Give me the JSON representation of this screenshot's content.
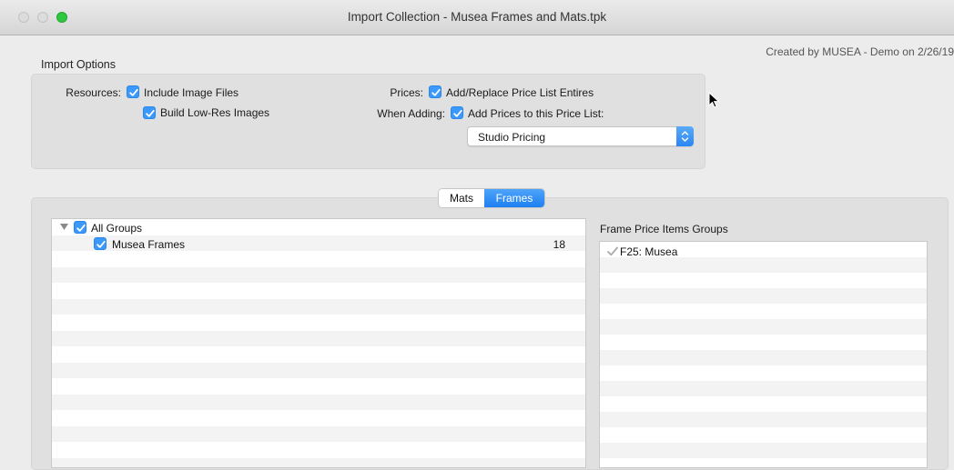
{
  "window": {
    "title": "Import Collection - Musea Frames and Mats.tpk",
    "created_by": "Created by MUSEA - Demo on 2/26/19"
  },
  "import_options": {
    "section_title": "Import Options",
    "resources_label": "Resources:",
    "include_image_files": {
      "label": "Include Image Files",
      "checked": true
    },
    "build_low_res_images": {
      "label": "Build Low-Res Images",
      "checked": true
    },
    "prices_label": "Prices:",
    "add_replace_price_list": {
      "label": "Add/Replace Price List Entires",
      "checked": true
    },
    "when_adding_label": "When Adding:",
    "add_prices_to_list": {
      "label": "Add Prices to this Price List:",
      "checked": true
    },
    "price_list_select": {
      "selected": "Studio Pricing"
    }
  },
  "tabs": [
    {
      "label": "Mats",
      "selected": false
    },
    {
      "label": "Frames",
      "selected": true
    }
  ],
  "groups_tree": {
    "rows": [
      {
        "label": "All Groups",
        "checked": true,
        "expanded": true,
        "count": ""
      },
      {
        "label": "Musea Frames",
        "checked": true,
        "count": "18"
      }
    ]
  },
  "frame_price_items": {
    "header": "Frame Price Items Groups",
    "rows": [
      {
        "label": "F25: Musea",
        "checked": true
      }
    ]
  },
  "colors": {
    "accent": "#3b99fc",
    "close_green": "#2fc73f"
  }
}
